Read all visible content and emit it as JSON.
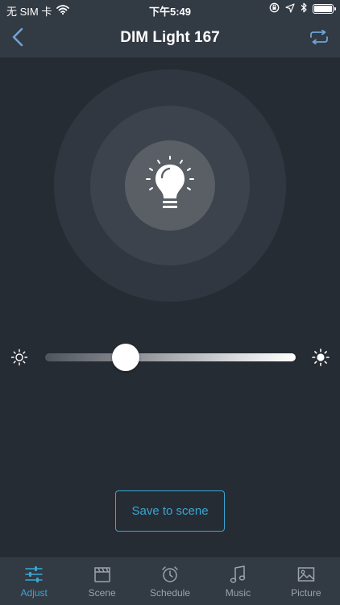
{
  "status_bar": {
    "carrier": "无 SIM 卡",
    "time": "下午5:49"
  },
  "nav": {
    "title": "DIM Light 167",
    "back_icon": "chevron-left-icon",
    "swap_icon": "swap-icon"
  },
  "light": {
    "icon": "lightbulb-icon",
    "brightness_fraction": 0.32
  },
  "save_button": {
    "label": "Save to scene"
  },
  "tabs": [
    {
      "label": "Adjust",
      "icon": "sliders-icon",
      "active": true
    },
    {
      "label": "Scene",
      "icon": "clapperboard-icon",
      "active": false
    },
    {
      "label": "Schedule",
      "icon": "alarm-clock-icon",
      "active": false
    },
    {
      "label": "Music",
      "icon": "music-note-icon",
      "active": false
    },
    {
      "label": "Picture",
      "icon": "picture-icon",
      "active": false
    }
  ],
  "colors": {
    "background": "#262c34",
    "bar": "#323a44",
    "accent": "#3aa7d3",
    "inactive": "#9ca3ab"
  }
}
